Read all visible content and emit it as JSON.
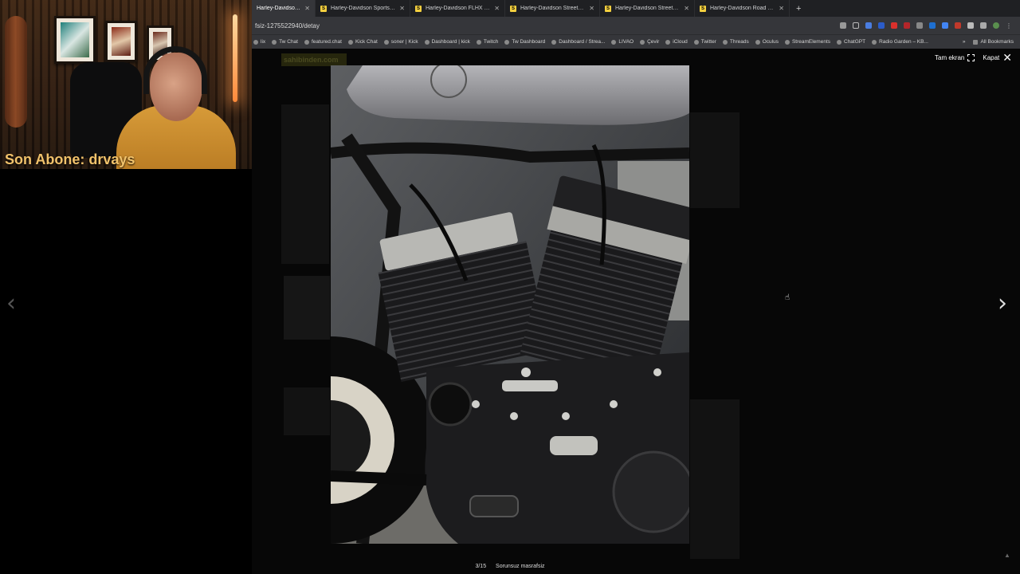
{
  "webcam": {
    "subscriber_label": "Son Abone: drvays"
  },
  "browser": {
    "tabs": [
      {
        "title": "Harley-Davidson Sportster X",
        "favicon": "S",
        "active": true
      },
      {
        "title": "Harley-Davidson Sportster X",
        "favicon": "S",
        "active": false
      },
      {
        "title": "Harley-Davidson FLHX Stree",
        "favicon": "S",
        "active": false
      },
      {
        "title": "Harley-Davidson Street Rod",
        "favicon": "S",
        "active": false
      },
      {
        "title": "Harley-Davidson Street Rod",
        "favicon": "S",
        "active": false
      },
      {
        "title": "Harley-Davidson Road Glide",
        "favicon": "S",
        "active": false
      }
    ],
    "new_tab_label": "+",
    "url": "fsiz-1275522940/detay",
    "bookmarks": [
      "lix",
      "Tw Chat",
      "featured.chat",
      "Kick Chat",
      "soner | Kick",
      "Dashboard | kick",
      "Twitch",
      "Tw Dashboard",
      "Dashboard / Strea...",
      "LIVAO",
      "Çevir",
      "iCloud",
      "Twitter",
      "Threads",
      "Oculus",
      "StreamElements",
      "ChatGPT",
      "Radio Garden – KB..."
    ],
    "bookmarks_overflow": "»",
    "all_bookmarks_label": "All Bookmarks"
  },
  "page_behind": {
    "logo_text": "sahibinden.com"
  },
  "lightbox": {
    "fullscreen_label": "Tam ekran",
    "close_label": "Kapat",
    "prev_arrow": "‹",
    "next_arrow": "›",
    "counter": "3/15",
    "caption": "Sorunsuz masrafsiz",
    "photo_subject": "Harley-Davidson Sportster V-twin engine close-up"
  },
  "colors": {
    "tab_favicon": "#f4d03f",
    "subscriber_text": "#f1c26b",
    "tank": "#9b9b9e",
    "engine": "#1d1d1f"
  }
}
